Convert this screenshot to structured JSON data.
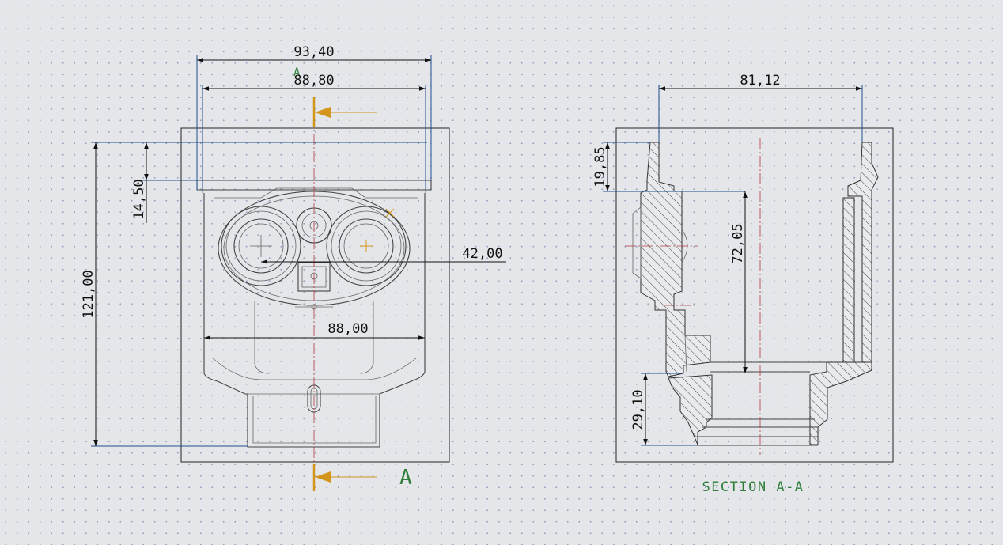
{
  "views": {
    "front": {
      "label_top": "A",
      "label_bottom": "A",
      "dimensions": {
        "overall_width": "93,40",
        "inner_width": "88,80",
        "body_width": "88,00",
        "port_offset": "42,00",
        "total_height": "121,00",
        "rim_height": "14,50"
      }
    },
    "section": {
      "title": "SECTION A-A",
      "dimensions": {
        "top_width": "81,12",
        "top_height": "19,85",
        "inner_depth": "72,05",
        "bottom_height": "29,10"
      }
    }
  },
  "colors": {
    "background": "#e4e6ea",
    "grid_dots": "#8fa3bf",
    "geometry": "#444444",
    "dimension": "#111111",
    "extension": "#1f4e8c",
    "centerline": "#b23a3a",
    "section_arrow": "#d4951c",
    "section_label": "#2e7d3a"
  }
}
